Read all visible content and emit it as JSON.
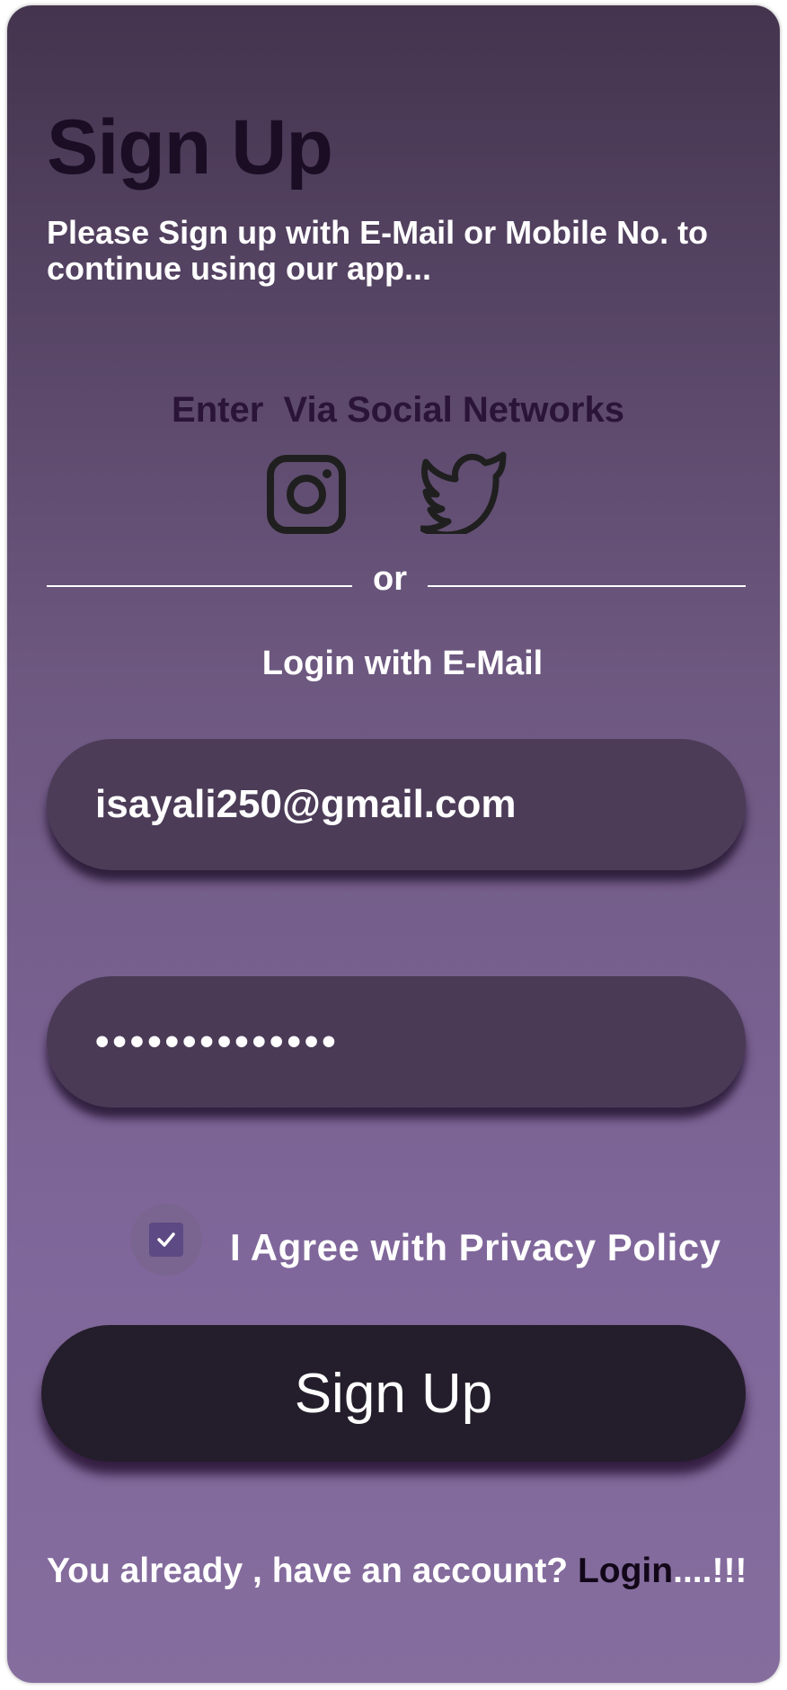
{
  "header": {
    "title": "Sign Up",
    "subtitle": "Please Sign up with E-Mail or Mobile No. to continue using our app..."
  },
  "social": {
    "heading_part1": "Enter",
    "heading_part2": "Via Social Networks",
    "icons": [
      "instagram-icon",
      "twitter-icon"
    ]
  },
  "divider": {
    "label": "or"
  },
  "email_section": {
    "heading": "Login with E-Mail"
  },
  "form": {
    "email_value": "isayali250@gmail.com",
    "password_value": "••••••••••••••",
    "agree_label": "I Agree with Privacy Policy",
    "agree_checked": true,
    "submit_label": "Sign Up"
  },
  "footer": {
    "prompt": "You already , have an account? ",
    "login_link": "Login",
    "suffix": "....!!!"
  },
  "colors": {
    "background_top": "#44344e",
    "background_bottom": "#856d9e",
    "title": "#1b0d24",
    "field": "#4c3c58",
    "button": "#241d2b",
    "checkbox": "#5d4983"
  }
}
